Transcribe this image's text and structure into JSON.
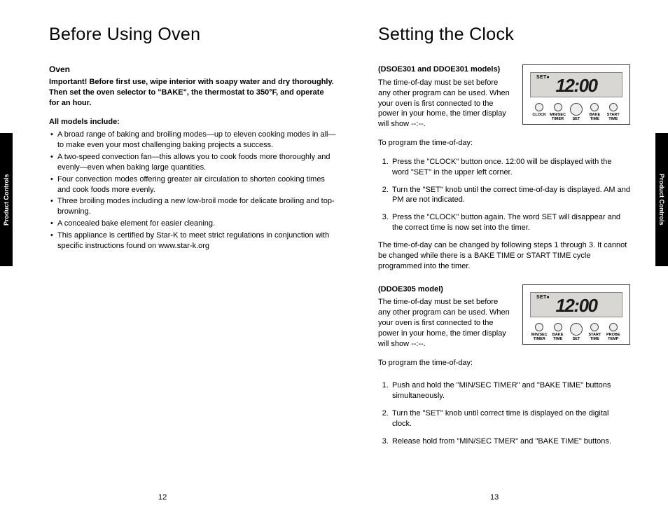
{
  "sidetabs": {
    "left": "Product Controls",
    "right": "Product Controls"
  },
  "left": {
    "title": "Before Using Oven",
    "h2": "Oven",
    "important": "Important! Before first use, wipe interior with soapy water and dry thoroughly. Then set the oven selector to \"BAKE\", the thermostat to 350°F, and operate for an hour.",
    "allmodels": "All models include:",
    "bullets": [
      "A broad range of baking and broiling modes—up to eleven cooking modes in all—to make even your most challenging baking projects a success.",
      "A two-speed convection fan—this allows you to cook foods more thoroughly and evenly—even when baking large quantities.",
      "Four convection modes offering greater air circulation to shorten cooking times and cook foods more evenly.",
      "Three broiling modes including a new low-broil mode for delicate broiling and top-browning.",
      "A concealed bake element for easier cleaning.",
      "This appliance is certified by Star-K to meet strict regulations in conjunction with specific instructions found on www.star-k.org"
    ],
    "pageno": "12"
  },
  "right": {
    "title": "Setting the Clock",
    "sec1": {
      "head": "(DSOE301 and DDOE301 models)",
      "intro": "The time-of-day must be set before any other program can be used. When your oven is first connected to the power in your home, the timer display will show --:--.",
      "toprog": "To program the time-of-day:",
      "steps": [
        "Press the \"CLOCK\" button once. 12:00 will be displayed with the word \"SET\" in the upper left corner.",
        "Turn the \"SET\" knob until the correct time-of-day is displayed. AM and PM are not indicated.",
        "Press the \"CLOCK\" button again. The word SET will disappear and the correct time is now set into the timer."
      ],
      "note": "The time-of-day can be changed by following steps 1 through 3. It cannot be changed while there is a BAKE TIME or START TIME cycle programmed into the timer.",
      "panel": {
        "set": "SET●",
        "time": "12:00",
        "btns": [
          "CLOCK",
          "MIN/SEC\nTIMER",
          "SET",
          "BAKE\nTIME",
          "START\nTIME"
        ]
      }
    },
    "sec2": {
      "head": "(DDOE305 model)",
      "intro": "The time-of-day must be set before any other program can be used. When your oven is first connected to the power in your home, the timer display will show --:--.",
      "toprog": "To program the time-of-day:",
      "steps": [
        "Push and hold the \"MIN/SEC TIMER\" and \"BAKE TIME\" buttons simultaneously.",
        "Turn the \"SET\" knob until correct time is displayed on the digital clock.",
        "Release hold from \"MIN/SEC TMER\" and \"BAKE TIME\" buttons."
      ],
      "panel": {
        "set": "SET●",
        "time": "12:00",
        "btns": [
          "MIN/SEC\nTIMER",
          "BAKE\nTIME",
          "SET",
          "START\nTIME",
          "PROBE\nTEMP"
        ]
      }
    },
    "pageno": "13"
  }
}
